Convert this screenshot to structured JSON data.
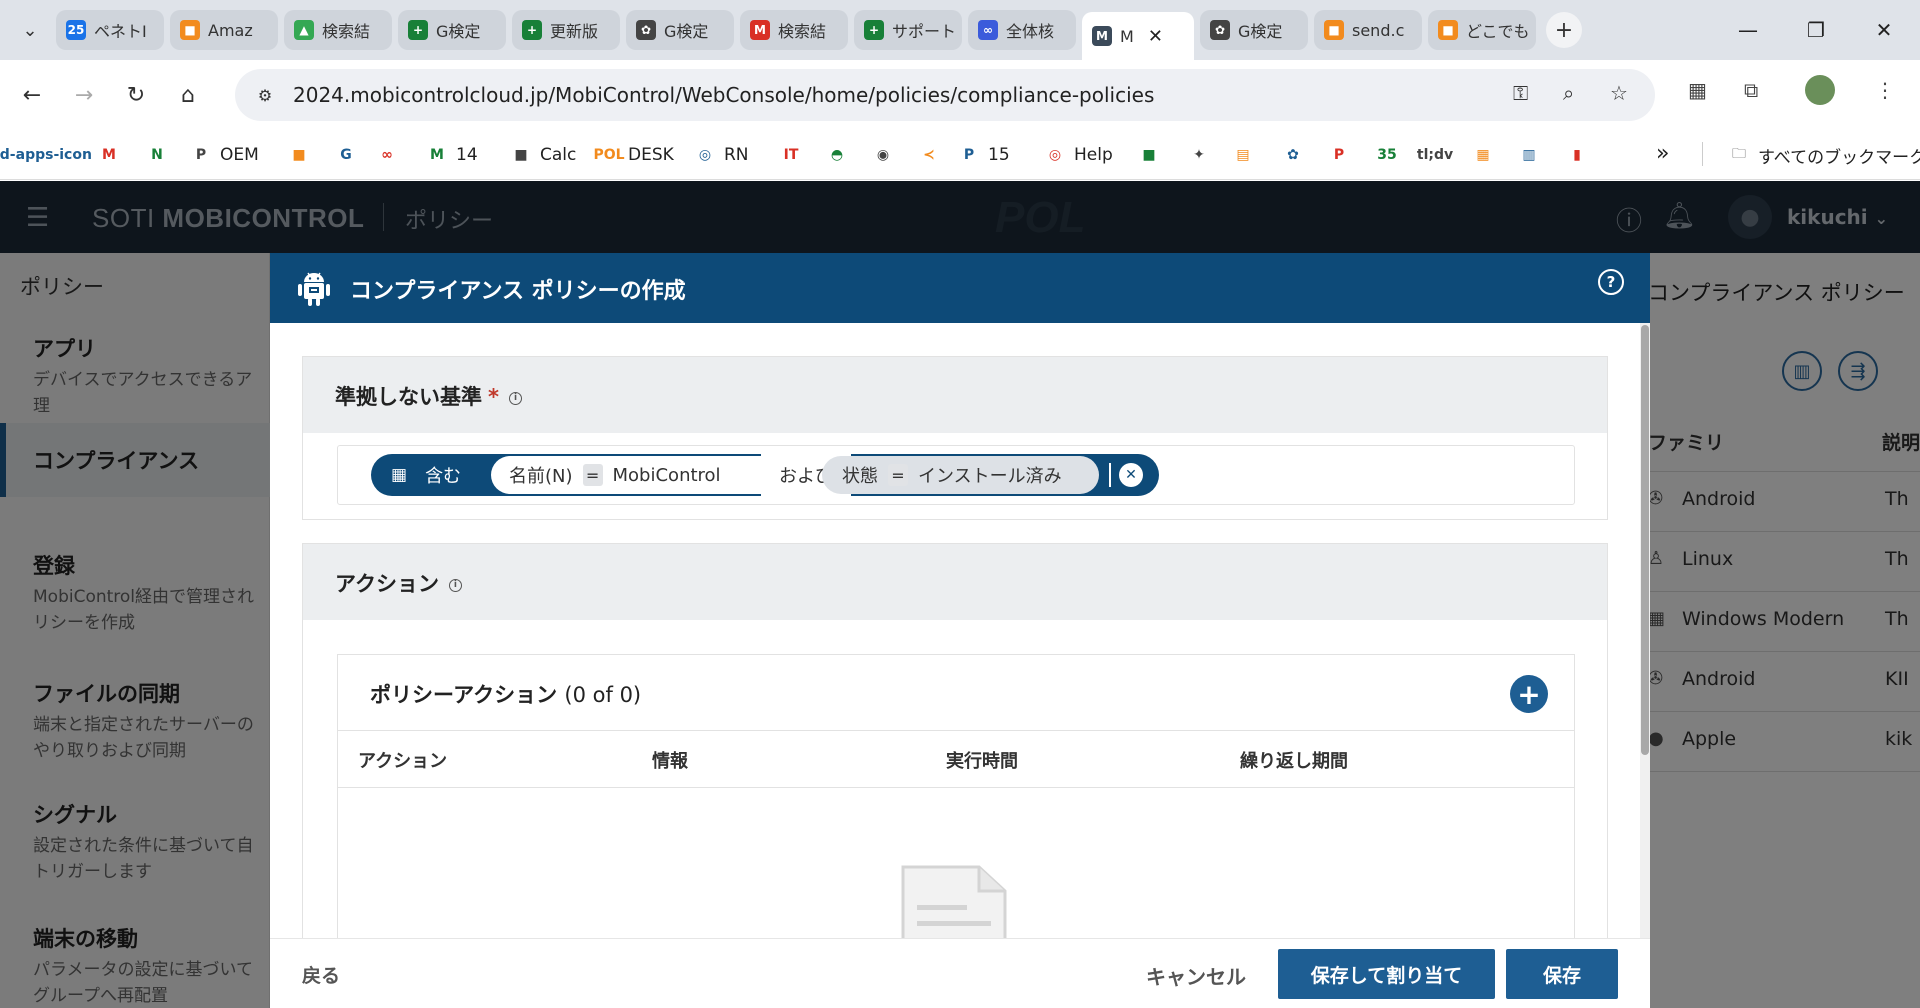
{
  "browser": {
    "tabs": [
      {
        "label": "ペネトI",
        "fav_color": "#1a73e8",
        "fav_text": "25"
      },
      {
        "label": "Amaz",
        "fav_color": "#f28b1e",
        "fav_text": "■"
      },
      {
        "label": "検索結",
        "fav_color": "#34a853",
        "fav_text": "▲"
      },
      {
        "label": "G検定",
        "fav_color": "#188038",
        "fav_text": "+"
      },
      {
        "label": "更新版",
        "fav_color": "#188038",
        "fav_text": "+"
      },
      {
        "label": "G検定",
        "fav_color": "#444444",
        "fav_text": "✿"
      },
      {
        "label": "検索結",
        "fav_color": "#d93025",
        "fav_text": "M"
      },
      {
        "label": "サポート",
        "fav_color": "#188038",
        "fav_text": "+"
      },
      {
        "label": "全体核",
        "fav_color": "#3b5bdb",
        "fav_text": "∞"
      },
      {
        "label": "M",
        "fav_color": "#3b4a5a",
        "fav_text": "M",
        "active": true
      },
      {
        "label": "G検定",
        "fav_color": "#444444",
        "fav_text": "✿"
      },
      {
        "label": "send.c",
        "fav_color": "#f28b1e",
        "fav_text": "■"
      },
      {
        "label": "どこでも",
        "fav_color": "#f28b1e",
        "fav_text": "■"
      }
    ],
    "url": "2024.mobicontrolcloud.jp/MobiControl/WebConsole/home/policies/compliance-policies",
    "bookmarks": [
      {
        "label": "",
        "icon": "grid-apps-icon"
      },
      {
        "label": "",
        "icon": "M"
      },
      {
        "label": "",
        "icon": "N"
      },
      {
        "label": "OEM",
        "icon": "P"
      },
      {
        "label": "",
        "icon": "■"
      },
      {
        "label": "",
        "icon": "G"
      },
      {
        "label": "",
        "icon": "∞"
      },
      {
        "label": "14",
        "icon": "M"
      },
      {
        "label": "Calc",
        "icon": "■"
      },
      {
        "label": "DESK",
        "icon": "POL"
      },
      {
        "label": "RN",
        "icon": "◎"
      },
      {
        "label": "",
        "icon": "IT"
      },
      {
        "label": "",
        "icon": "◓"
      },
      {
        "label": "",
        "icon": "◉"
      },
      {
        "label": "",
        "icon": "≺"
      },
      {
        "label": "15",
        "icon": "P"
      },
      {
        "label": "Help",
        "icon": "◎"
      },
      {
        "label": "",
        "icon": "■"
      },
      {
        "label": "",
        "icon": "✦"
      },
      {
        "label": "",
        "icon": "▤"
      },
      {
        "label": "",
        "icon": "✿"
      },
      {
        "label": "",
        "icon": "P"
      },
      {
        "label": "",
        "icon": "35"
      },
      {
        "label": "",
        "icon": "tl;dv"
      },
      {
        "label": "",
        "icon": "▦"
      },
      {
        "label": "",
        "icon": "▥"
      },
      {
        "label": "",
        "icon": "▮"
      }
    ],
    "bookmarks_more": "»",
    "all_bookmarks": "すべてのブックマーク"
  },
  "app": {
    "brand_light": "SOTI ",
    "brand_bold": "MOBICONTROL",
    "section": "ポリシー",
    "center_logo": "POL",
    "username": "kikuchi"
  },
  "sidebar": {
    "heading": "ポリシー",
    "items": [
      {
        "title": "アプリ",
        "desc": "デバイスでアクセスできるア\n理"
      },
      {
        "title": "コンプライアンス",
        "desc": "",
        "active": true
      },
      {
        "title": "登録",
        "desc": "MobiControl経由で管理され\nリシーを作成"
      },
      {
        "title": "ファイルの同期",
        "desc": "端末と指定されたサーバーの\nやり取りおよび同期"
      },
      {
        "title": "シグナル",
        "desc": "設定された条件に基づいて自\nトリガーします"
      },
      {
        "title": "端末の移動",
        "desc": "パラメータの設定に基づいて\nグループへ再配置"
      }
    ]
  },
  "right_pane": {
    "title": "コンプライアンス ポリシー",
    "col_family": "ファミリ",
    "col_desc": "説明",
    "rows": [
      {
        "icon": "android-icon",
        "name": "Android",
        "desc": "Th"
      },
      {
        "icon": "linux-icon",
        "name": "Linux",
        "desc": "Th"
      },
      {
        "icon": "windows-icon",
        "name": "Windows Modern",
        "desc": "Th"
      },
      {
        "icon": "android-icon",
        "name": "Android",
        "desc": "KII"
      },
      {
        "icon": "apple-icon",
        "name": "Apple",
        "desc": "kik"
      }
    ]
  },
  "modal": {
    "title": "コンプライアンス ポリシーの作成",
    "criteria": {
      "title": "準拠しない基準",
      "required_mark": "*",
      "contains": "含む",
      "cond1_key": "名前(N)",
      "cond1_op": "=",
      "cond1_val": "MobiControl",
      "and_label": "および",
      "cond2_key": "状態",
      "cond2_op": "=",
      "cond2_val": "インストール済み"
    },
    "actions": {
      "title": "アクション",
      "policy_actions_title": "ポリシーアクション",
      "policy_actions_count": "(0 of 0)",
      "columns": [
        "アクション",
        "情報",
        "実行時間",
        "繰り返し期間"
      ]
    },
    "footer": {
      "back": "戻る",
      "cancel": "キャンセル",
      "save_assign": "保存して割り当て",
      "save": "保存"
    }
  }
}
